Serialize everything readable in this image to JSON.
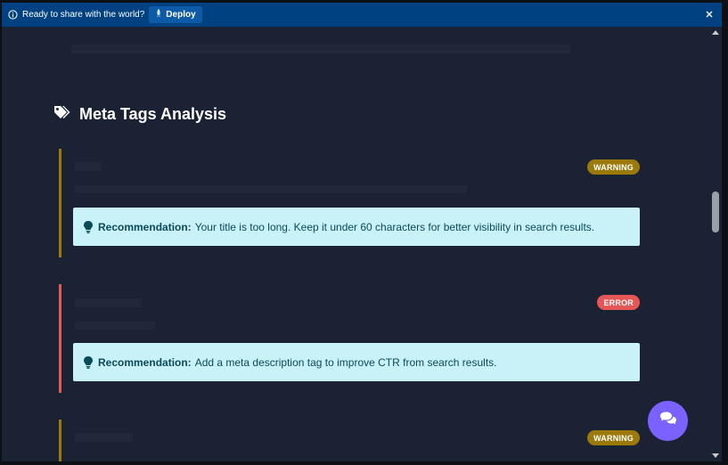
{
  "banner": {
    "message": "Ready to share with the world?",
    "deploy_label": "Deploy"
  },
  "section": {
    "title": "Meta Tags Analysis"
  },
  "cards": [
    {
      "status": "WARNING",
      "status_color": "#9b7a0b",
      "recommendation_label": "Recommendation:",
      "recommendation_text": "Your title is too long. Keep it under 60 characters for better visibility in search results."
    },
    {
      "status": "ERROR",
      "status_color": "#e55757",
      "recommendation_label": "Recommendation:",
      "recommendation_text": "Add a meta description tag to improve CTR from search results."
    },
    {
      "status": "WARNING",
      "status_color": "#9b7a0b"
    }
  ],
  "colors": {
    "background": "#1b2233",
    "banner": "#004281",
    "recommendation_bg": "#c8f2f8",
    "chat_button": "#7b61ff"
  },
  "icons": {
    "info": "info-icon",
    "deploy": "rocket-icon",
    "close": "close-icon",
    "section": "tags-icon",
    "recommendation": "lightbulb-icon",
    "chat": "chat-bubbles-icon"
  }
}
